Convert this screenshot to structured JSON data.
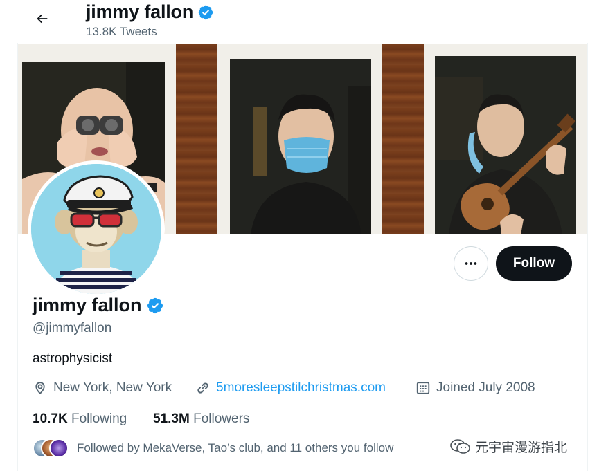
{
  "header": {
    "name": "jimmy fallon",
    "tweet_count": "13.8K Tweets"
  },
  "profile": {
    "name": "jimmy fallon",
    "handle": "@jimmyfallon",
    "bio": "astrophysicist",
    "location": "New York, New York",
    "website": "5moresleepstilchristmas.com",
    "joined": "Joined July 2008",
    "following_count": "10.7K",
    "following_label": "Following",
    "followers_count": "51.3M",
    "followers_label": "Followers",
    "followed_by": "Followed by MekaVerse, Tao’s club, and 11 others you follow"
  },
  "actions": {
    "follow_label": "Follow"
  },
  "watermark": {
    "text": "元宇宙漫游指北"
  },
  "colors": {
    "accent": "#1d9bf0",
    "text_primary": "#0f1419",
    "text_secondary": "#536471",
    "follow_button": "#0f1419",
    "avatar_bg": "#8fd6ea"
  },
  "icons": [
    "back-arrow-icon",
    "verified-badge-icon",
    "more-dots-icon",
    "location-pin-icon",
    "link-icon",
    "calendar-icon",
    "wechat-icon"
  ]
}
